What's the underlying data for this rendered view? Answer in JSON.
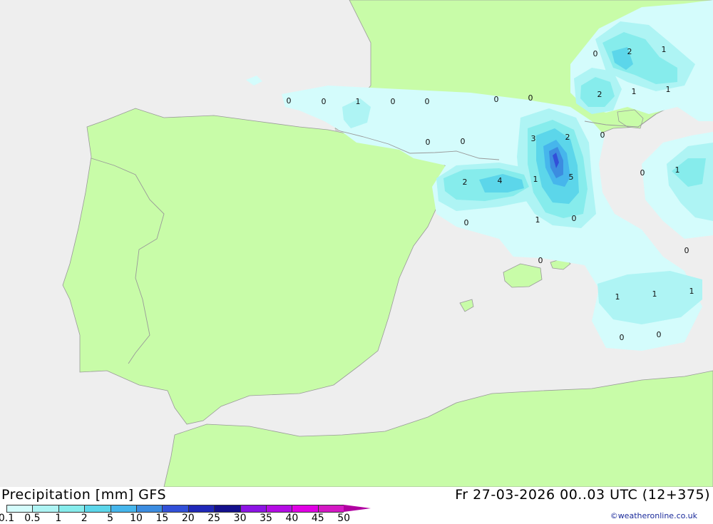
{
  "header": {
    "title_left": "Precipitation [mm] GFS",
    "title_right": "Fr 27-03-2026 00..03 UTC (12+375)"
  },
  "credit": "©weatheronline.co.uk",
  "colors": {
    "sea": "#eeeeee",
    "land": "#c8fca8",
    "border": "#999999"
  },
  "legend": {
    "labels": [
      "0.1",
      "0.5",
      "1",
      "2",
      "5",
      "10",
      "15",
      "20",
      "25",
      "30",
      "35",
      "40",
      "45",
      "50"
    ],
    "colors": [
      "#d4fcfc",
      "#aef4f4",
      "#86ecec",
      "#5cd6ea",
      "#46b6ec",
      "#3c8ce0",
      "#3250d8",
      "#2028b8",
      "#14108c",
      "#8c14e4",
      "#b40ce4",
      "#e000e4",
      "#d418c4",
      "#b000a0"
    ]
  },
  "map": {
    "contour_labels": [
      "0",
      "0",
      "1",
      "0",
      "0",
      "0",
      "0",
      "0",
      "0",
      "0",
      "2",
      "1",
      "1",
      "2",
      "1",
      "3",
      "2",
      "0",
      "2",
      "4",
      "1",
      "5",
      "0",
      "1",
      "0",
      "0",
      "1",
      "0",
      "0",
      "1",
      "1",
      "1",
      "0",
      "0"
    ]
  }
}
